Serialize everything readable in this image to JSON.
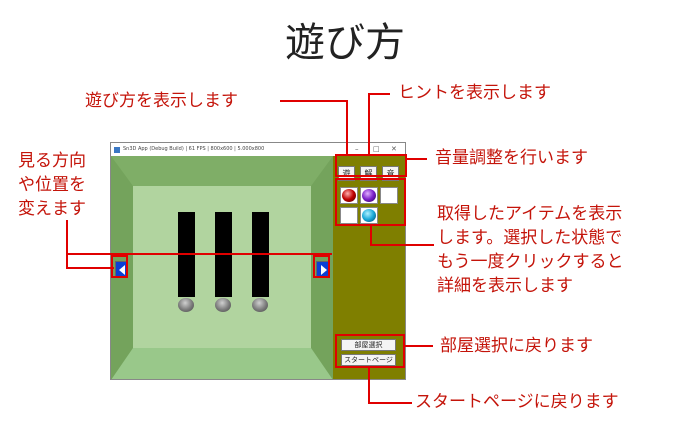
{
  "page": {
    "title": "遊び方"
  },
  "callouts": {
    "howto": "遊び方を表示します",
    "hint": "ヒントを表示します",
    "volume": "音量調整を行います",
    "view_l1": "見る方向",
    "view_l2": "や位置を",
    "view_l3": "変えます",
    "items_l1": "取得したアイテムを表示",
    "items_l2": "します。選択した状態で",
    "items_l3": "もう一度クリックすると",
    "items_l4": "詳細を表示します",
    "room": "部屋選択に戻ります",
    "start": "スタートページに戻ります"
  },
  "app": {
    "window_title": "Sn3D App (Debug Build) | 61 FPS | 800x600 | 5.000x800",
    "buttons": {
      "howto": "遊",
      "hint": "解",
      "volume": "音"
    },
    "room_select": "部屋選択",
    "start_page": "スタートページ"
  },
  "colors": {
    "accent": "#e00000",
    "scene": "#7fb06a",
    "sidebar": "#7f7f00",
    "arrow": "#0a3fd6"
  },
  "icons": {
    "left": "arrow-left-icon",
    "right": "arrow-right-icon"
  }
}
